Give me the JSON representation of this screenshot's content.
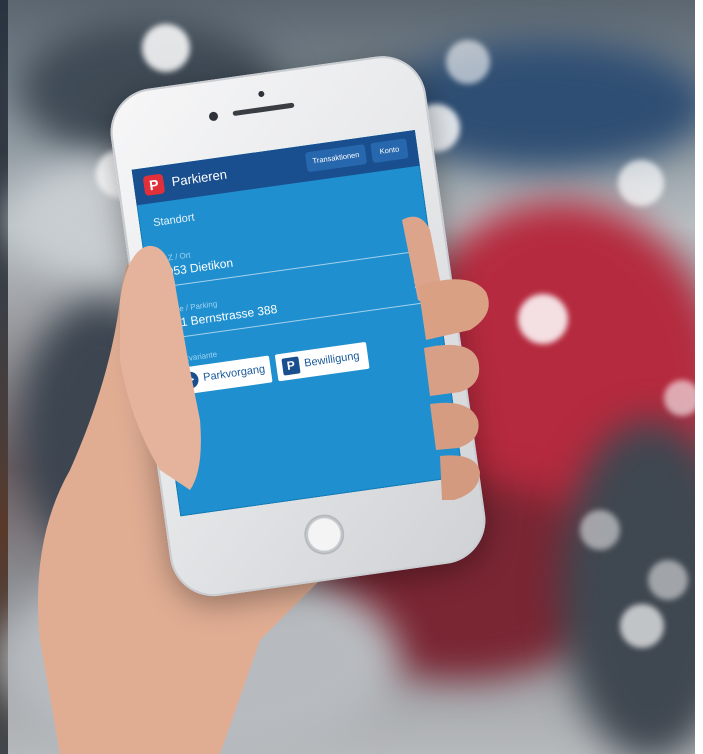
{
  "app": {
    "title": "Parkieren",
    "logo_letter": "P",
    "tabs": [
      "Transaktionen",
      "Konto"
    ]
  },
  "section_title": "Standort",
  "fields": [
    {
      "label": "PLZ / Ort",
      "value": "8953 Dietikon",
      "chevron": "›"
    },
    {
      "label": "Zone / Parking",
      "value": "201 Bernstrasse 388",
      "chevron": "›"
    }
  ],
  "parkvariante": {
    "label": "Parkvariante",
    "buttons": [
      {
        "label": "Parkvorgang",
        "icon": "play-icon"
      },
      {
        "label": "Bewilligung",
        "icon": "parking-p-icon",
        "icon_letter": "P"
      }
    ]
  },
  "colors": {
    "screen_blue": "#1f8fcf",
    "appbar_blue": "#1a4f8f",
    "logo_red": "#e1303a"
  }
}
